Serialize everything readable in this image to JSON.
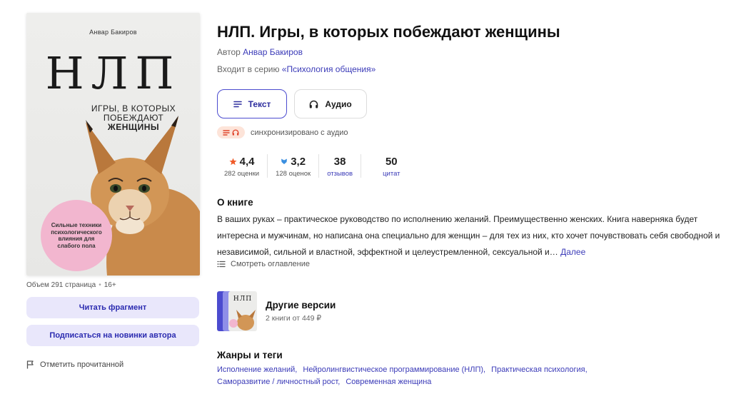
{
  "cover": {
    "author": "Анвар Бакиров",
    "title": "НЛП",
    "subtitle_line1": "ИГРЫ, В КОТОРЫХ",
    "subtitle_line2": "ПОБЕЖДАЮТ",
    "subtitle_line3": "ЖЕНЩИНЫ",
    "badge": "Сильные техники психологического влияния для слабого пола"
  },
  "meta": {
    "pages": "Объем 291 страница",
    "age": "16+"
  },
  "actions": {
    "read_fragment": "Читать фрагмент",
    "subscribe": "Подписаться на новинки автора",
    "mark_read": "Отметить прочитанной"
  },
  "book": {
    "title": "НЛП. Игры, в которых побеждают женщины",
    "author_label": "Автор",
    "author_name": "Анвар Бакиров",
    "series_label": "Входит в серию",
    "series_name": "«Психология общения»"
  },
  "formats": {
    "text": "Текст",
    "audio": "Аудио",
    "sync_note": "синхронизировано с аудио"
  },
  "stats": {
    "rating": "4,4",
    "rating_count": "282 оценки",
    "second_rating": "3,2",
    "second_count": "128 оценок",
    "reviews": "38",
    "reviews_label": "отзывов",
    "quotes": "50",
    "quotes_label": "цитат"
  },
  "about": {
    "heading": "О книге",
    "text": "В ваших руках – практическое руководство по исполнению желаний. Преимущественно женских. Книга наверняка будет интересна и мужчинам, но написана она специально для женщин – для тех из них, кто хочет почувствовать себя свободной и независимой, сильной и властной, эффектной и целеустремленной, сексуальной и…",
    "more": "Далее",
    "toc": "Смотреть оглавление"
  },
  "versions": {
    "title": "Другие версии",
    "sub": "2 книги от 449 ₽",
    "thumb_label": "НЛП"
  },
  "genres": {
    "heading": "Жанры и теги",
    "tags": [
      "Исполнение желаний,",
      "Нейролингвистическое программирование (НЛП),",
      "Практическая психология,",
      "Саморазвитие / личностный рост,",
      "Современная женщина"
    ]
  },
  "colors": {
    "accent": "#3b3bb8",
    "button_bg": "#e9e7fb",
    "star": "#f05a28",
    "shield": "#3a8fe0",
    "sync_bg": "#fde4d9",
    "badge_pink": "#f2b6cf"
  }
}
